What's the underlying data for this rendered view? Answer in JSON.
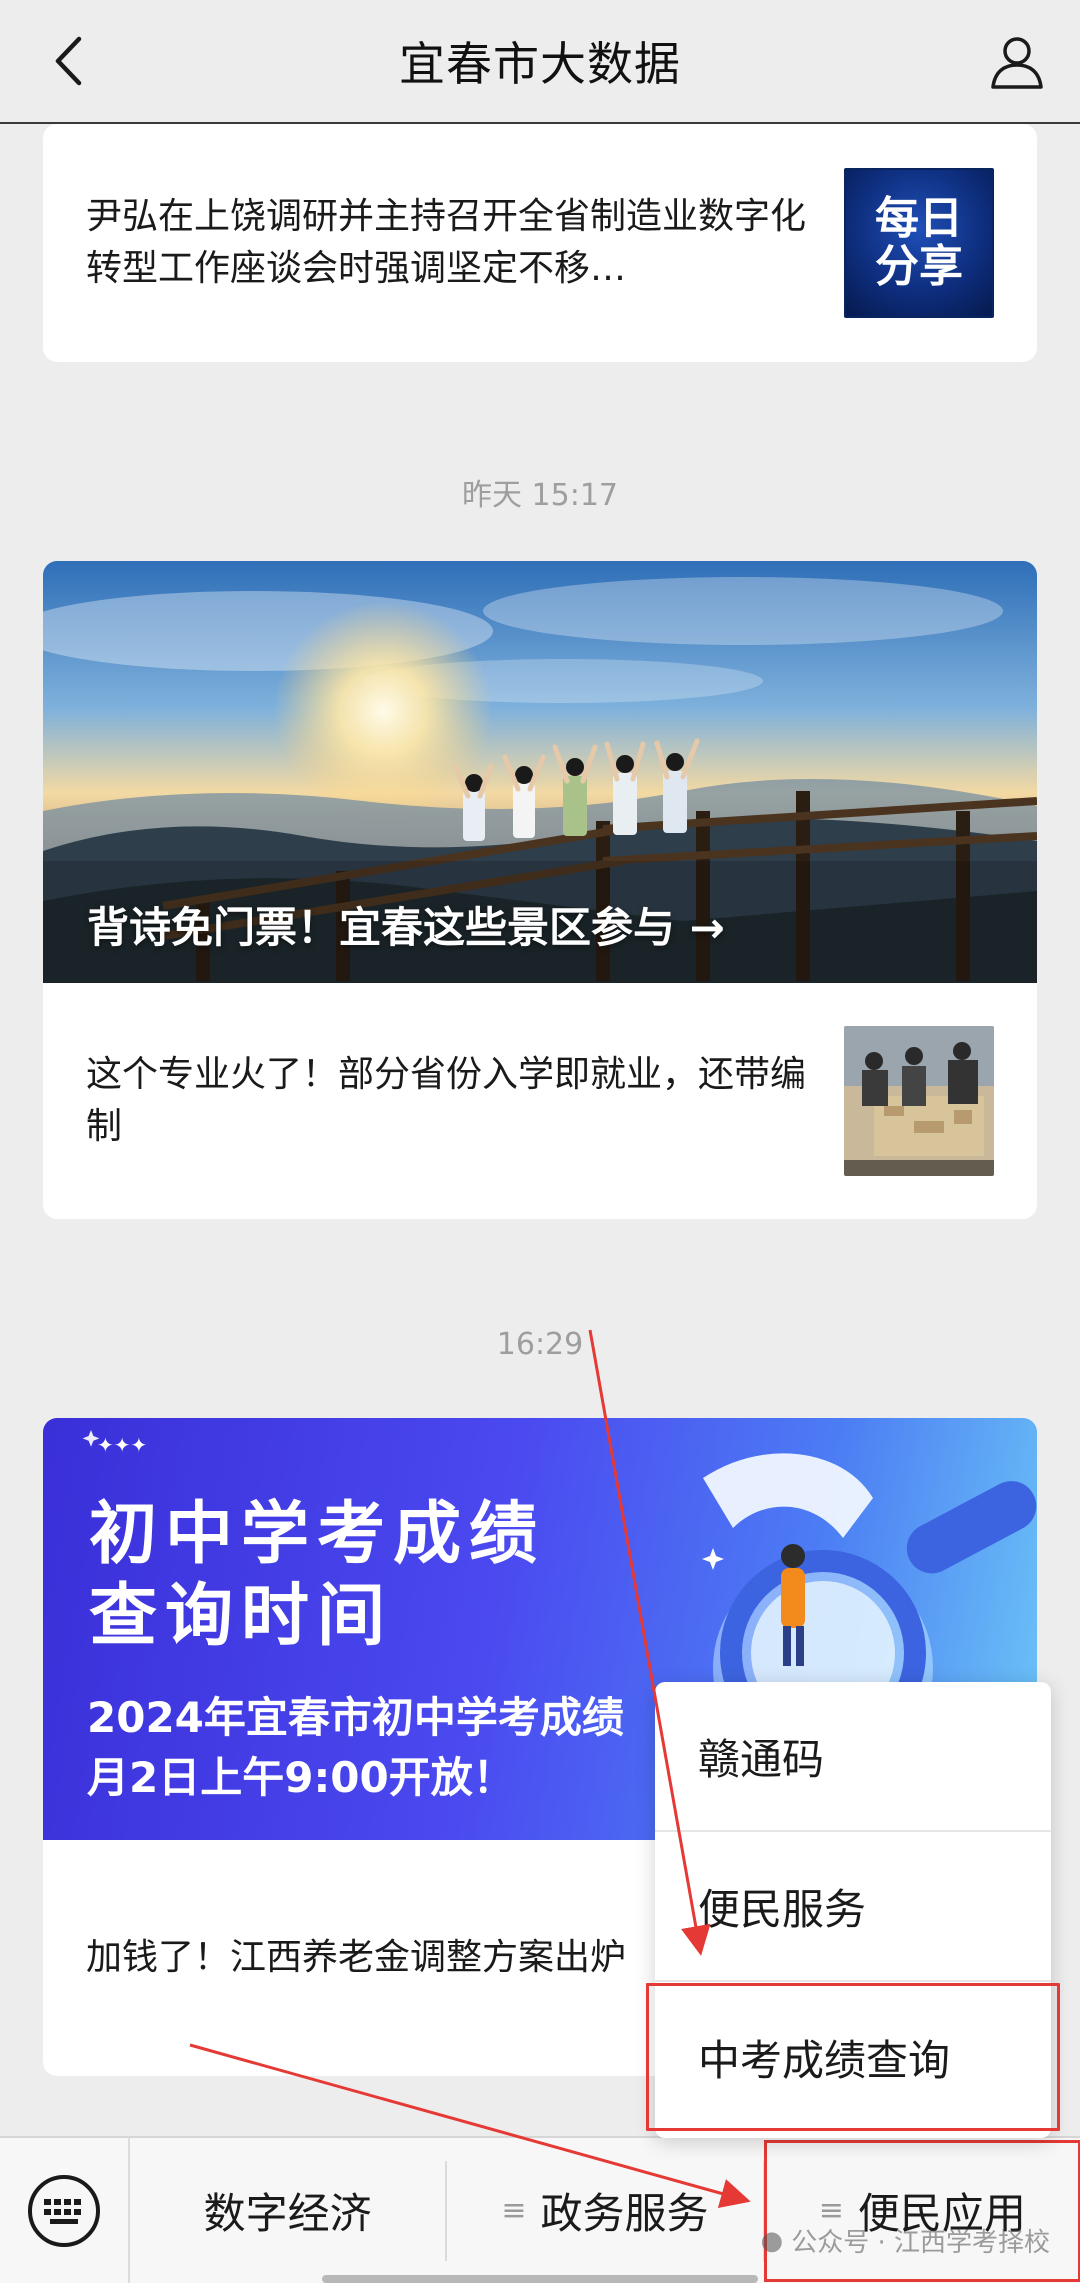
{
  "header": {
    "title": "宜春市大数据",
    "back_icon": "chevron-left-icon",
    "profile_icon": "person-icon"
  },
  "articles": {
    "item1": {
      "text": "尹弘在上饶调研并主持召开全省制造业数字化转型工作座谈会时强调坚定不移…",
      "thumb_text": "每日\n分享"
    },
    "time1": "昨天 15:17",
    "banner1": {
      "caption": "背诗免门票！宜春这些景区参与 →"
    },
    "item2": {
      "text": "这个专业火了！部分省份入学即就业，还带编制"
    },
    "time2": "16:29",
    "banner2": {
      "title_line1": "初中学考成绩",
      "title_line2": "查询时间",
      "sub_line1": "2024年宜春市初中学考成绩",
      "sub_line2": "月2日上午9:00开放！"
    },
    "item3": {
      "text": "加钱了！江西养老金调整方案出炉"
    }
  },
  "popup_menu": {
    "items": [
      "赣通码",
      "便民服务",
      "中考成绩查询"
    ]
  },
  "bottom_menu": {
    "keyboard_icon": "keyboard-icon",
    "items": [
      "数字经济",
      "政务服务",
      "便民应用"
    ]
  },
  "watermark": "公众号 · 江西学考择校",
  "colors": {
    "highlight": "#e53935",
    "background": "#ededed"
  }
}
